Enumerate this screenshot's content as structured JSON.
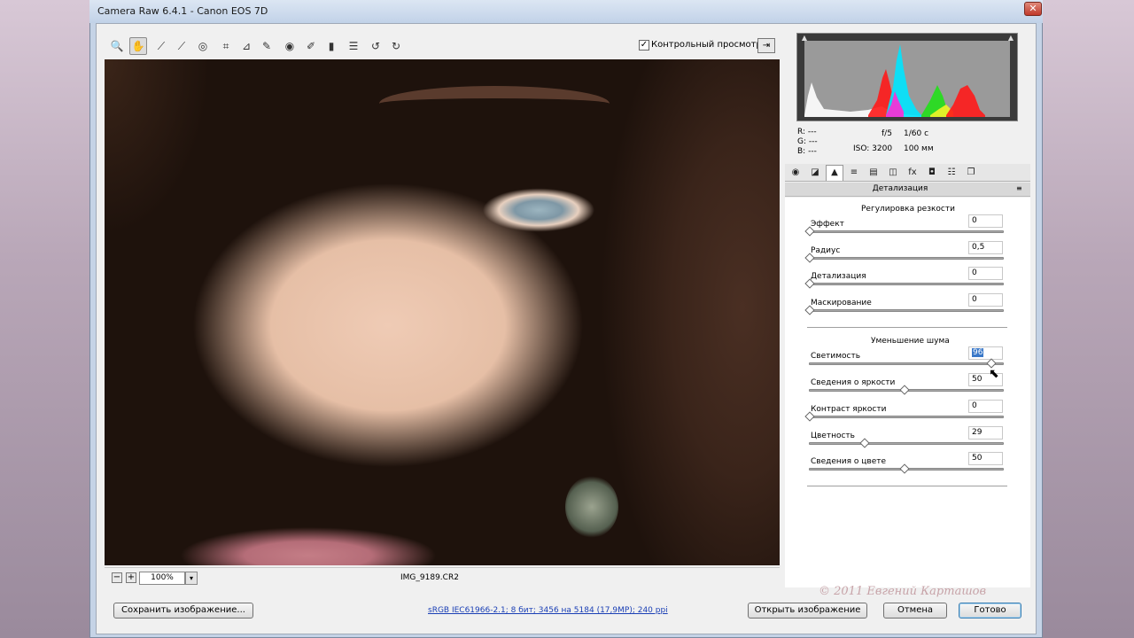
{
  "window": {
    "title": "Camera Raw 6.4.1  -  Canon EOS 7D",
    "close_glyph": "✕"
  },
  "toolbar": {
    "tools": [
      {
        "name": "zoom-tool",
        "glyph": "🔍"
      },
      {
        "name": "hand-tool",
        "glyph": "✋"
      },
      {
        "name": "white-balance-tool",
        "glyph": "⟋"
      },
      {
        "name": "color-sampler-tool",
        "glyph": "⟋"
      },
      {
        "name": "targeted-adjustment-tool",
        "glyph": "◎"
      },
      {
        "name": "crop-tool",
        "glyph": "⌗"
      },
      {
        "name": "straighten-tool",
        "glyph": "⊿"
      },
      {
        "name": "spot-removal-tool",
        "glyph": "✎"
      },
      {
        "name": "red-eye-tool",
        "glyph": "◉"
      },
      {
        "name": "adjustment-brush-tool",
        "glyph": "✐"
      },
      {
        "name": "graduated-filter-tool",
        "glyph": "▮"
      },
      {
        "name": "preferences-tool",
        "glyph": "☰"
      },
      {
        "name": "rotate-ccw-tool",
        "glyph": "↺"
      },
      {
        "name": "rotate-cw-tool",
        "glyph": "↻"
      }
    ],
    "preview_checked": true,
    "preview_check_glyph": "✓",
    "preview_label": "Контрольный просмотр",
    "fullscreen_glyph": "⇥"
  },
  "status": {
    "zoom_out_glyph": "−",
    "zoom_in_glyph": "+",
    "zoom_value": "100%",
    "zoom_drop_glyph": "▾",
    "filename": "IMG_9189.CR2"
  },
  "histogram": {
    "shadow_clip_glyph": "▲",
    "highlight_clip_glyph": "▲",
    "colors": {
      "red": "#ff1a1a",
      "cyan": "#00e5ff",
      "magenta": "#ff2bd6",
      "green": "#22e01a",
      "yellow": "#f3f32a",
      "white": "#ffffff",
      "gray": "#9a9a9a"
    }
  },
  "readout": {
    "r": "R:  ---",
    "g": "G:  ---",
    "b": "B:  ---",
    "aperture": "f/5",
    "shutter": "1/60 с",
    "iso": "ISO: 3200",
    "focal": "100 мм"
  },
  "tabs": [
    {
      "name": "tab-basic",
      "glyph": "◉"
    },
    {
      "name": "tab-tone-curve",
      "glyph": "◪"
    },
    {
      "name": "tab-detail",
      "glyph": "▲"
    },
    {
      "name": "tab-hsl",
      "glyph": "≡"
    },
    {
      "name": "tab-split-toning",
      "glyph": "▤"
    },
    {
      "name": "tab-lens-corrections",
      "glyph": "◫"
    },
    {
      "name": "tab-effects",
      "glyph": "fx"
    },
    {
      "name": "tab-camera-calibration",
      "glyph": "◘"
    },
    {
      "name": "tab-presets",
      "glyph": "☷"
    },
    {
      "name": "tab-snapshots",
      "glyph": "❐"
    }
  ],
  "panel": {
    "title": "Детализация",
    "menu_glyph": "≡",
    "sharpening": {
      "title": "Регулировка резкости",
      "sliders": [
        {
          "label": "Эффект",
          "value": "0",
          "level": 0.0
        },
        {
          "label": "Радиус",
          "value": "0,5",
          "level": 0.0
        },
        {
          "label": "Детализация",
          "value": "0",
          "level": 0.0
        },
        {
          "label": "Маскирование",
          "value": "0",
          "level": 0.0
        }
      ]
    },
    "noise": {
      "title": "Уменьшение шума",
      "sliders": [
        {
          "label": "Светимость",
          "value": "96",
          "level": 0.96,
          "selected": true
        },
        {
          "label": "Сведения о яркости",
          "value": "50",
          "level": 0.5
        },
        {
          "label": "Контраст яркости",
          "value": "0",
          "level": 0.0
        },
        {
          "label": "Цветность",
          "value": "29",
          "level": 0.29
        },
        {
          "label": "Сведения о цвете",
          "value": "50",
          "level": 0.5
        }
      ]
    }
  },
  "watermark": "© 2011 Евгений Карташов",
  "footer": {
    "save_label": "Сохранить изображение...",
    "workflow_link": "sRGB IEC61966-2.1; 8 бит; 3456 на 5184 (17,9MP); 240 ppi",
    "open_label": "Открыть изображение",
    "cancel_label": "Отмена",
    "done_label": "Готово"
  }
}
